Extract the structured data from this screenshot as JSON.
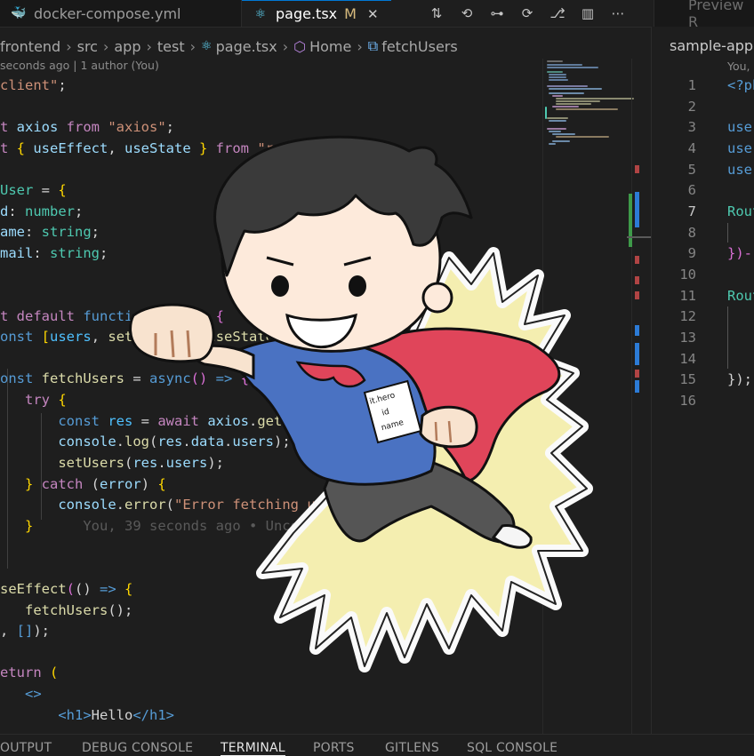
{
  "tabs": [
    {
      "name": "docker-compose.yml",
      "icon": "docker-icon"
    },
    {
      "name": "page.tsx",
      "icon": "react-icon",
      "modified": "M"
    }
  ],
  "preview_tab": "Preview R",
  "breadcrumb": [
    "frontend",
    "src",
    "app",
    "test",
    "page.tsx",
    "Home",
    "fetchUsers"
  ],
  "blame": "seconds ago | 1 author (You)",
  "inline_blame": "You, 39 seconds ago • Uncommitted",
  "right_pane": {
    "title": "sample-app",
    "blame": "You,",
    "line_numbers": [
      "1",
      "2",
      "3",
      "4",
      "5",
      "6",
      "7",
      "8",
      "9",
      "10",
      "11",
      "12",
      "13",
      "14",
      "15",
      "16"
    ],
    "current_line": "7",
    "code": [
      "<?ph",
      "",
      "use",
      "use",
      "use",
      "",
      "Rout",
      "",
      "})-",
      "",
      "Rout",
      "",
      "",
      "",
      "});",
      ""
    ]
  },
  "panel_tabs": [
    "OUTPUT",
    "DEBUG CONSOLE",
    "TERMINAL",
    "PORTS",
    "GITLENS",
    "SQL CONSOLE"
  ],
  "active_panel_tab": "TERMINAL",
  "sticker_badge": [
    "it.hero",
    "id",
    "name"
  ],
  "colors": {
    "accent": "#0078d4",
    "modified": "#d7ba7d",
    "cape": "#e0455a",
    "shirt": "#4a72c2",
    "burst": "#f4eeb0"
  }
}
